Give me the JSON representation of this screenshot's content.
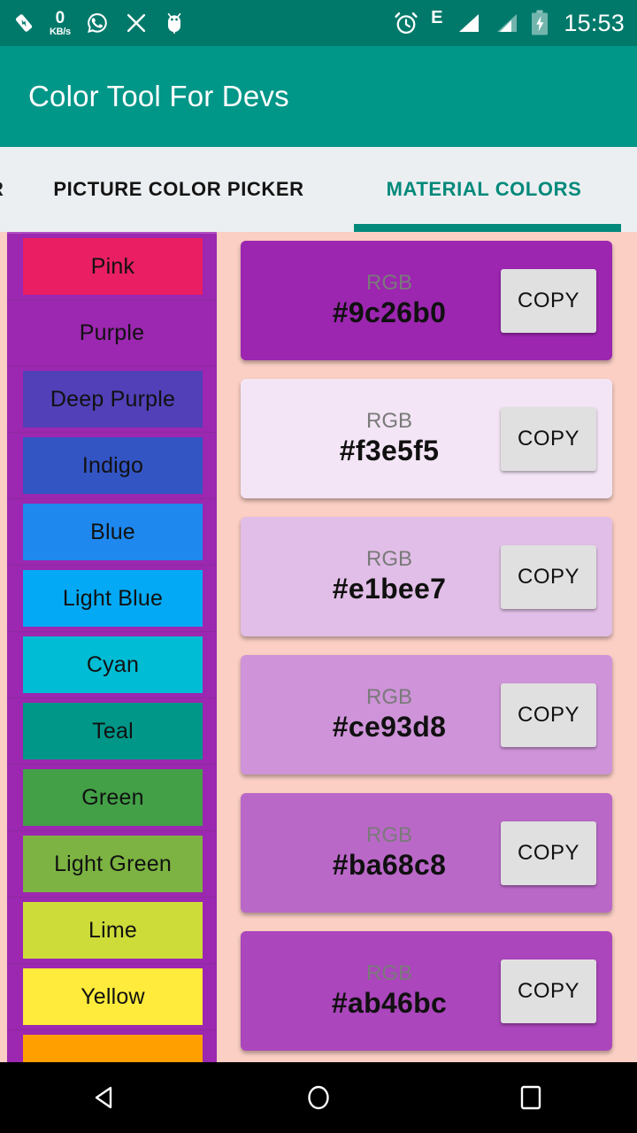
{
  "statusbar": {
    "left_icons": [
      {
        "name": "battery-saver-icon"
      },
      {
        "name": "network-speed-icon",
        "value": "0",
        "unit": "KB/s"
      },
      {
        "name": "whatsapp-icon"
      },
      {
        "name": "close-icon"
      },
      {
        "name": "android-debug-icon"
      }
    ],
    "alarm_icon": "alarm-icon",
    "network_type": "E",
    "signal_icon_1": "signal-bars-icon",
    "signal_icon_2": "signal-bars-icon",
    "battery_icon": "battery-charging-icon",
    "clock": "15:53"
  },
  "appbar": {
    "title": "Color Tool For Devs",
    "background": "#009688"
  },
  "tabs": {
    "items": [
      {
        "label": "R",
        "selected": false,
        "partial": true
      },
      {
        "label": "PICTURE COLOR PICKER",
        "selected": false,
        "partial": false
      },
      {
        "label": "MATERIAL COLORS",
        "selected": true,
        "partial": false
      }
    ],
    "indicator_color": "#00897b",
    "bar_background": "#eceff1"
  },
  "content": {
    "background": "#fbcfc4",
    "sidebar_background": "#9c27b0"
  },
  "color_list": {
    "items": [
      {
        "label": "Pink",
        "swatch": "#e91e63",
        "selected": false
      },
      {
        "label": "Purple",
        "swatch": "#9c27b0",
        "selected": true
      },
      {
        "label": "Deep Purple",
        "swatch": "#5140b7",
        "selected": false
      },
      {
        "label": "Indigo",
        "swatch": "#3355c4",
        "selected": false
      },
      {
        "label": "Blue",
        "swatch": "#1e88ef",
        "selected": false
      },
      {
        "label": "Light Blue",
        "swatch": "#03a9f4",
        "selected": false
      },
      {
        "label": "Cyan",
        "swatch": "#00bcd4",
        "selected": false
      },
      {
        "label": "Teal",
        "swatch": "#009688",
        "selected": false
      },
      {
        "label": "Green",
        "swatch": "#43a047",
        "selected": false
      },
      {
        "label": "Light Green",
        "swatch": "#7cb342",
        "selected": false
      },
      {
        "label": "Lime",
        "swatch": "#cddc39",
        "selected": false
      },
      {
        "label": "Yellow",
        "swatch": "#ffeb3b",
        "selected": false
      },
      {
        "label": "",
        "swatch": "#ffa000",
        "selected": false
      }
    ]
  },
  "shades": {
    "rgb_label": "RGB",
    "copy_label": "COPY",
    "items": [
      {
        "hex": "#9c26b0",
        "background": "#9c26b0"
      },
      {
        "hex": "#f3e5f5",
        "background": "#f3e5f5"
      },
      {
        "hex": "#e1bee7",
        "background": "#e1bee7"
      },
      {
        "hex": "#ce93d8",
        "background": "#ce93d8"
      },
      {
        "hex": "#ba68c8",
        "background": "#ba68c8"
      },
      {
        "hex": "#ab46bc",
        "background": "#ab46bc"
      }
    ]
  },
  "navbar": {
    "back": "back-icon",
    "home": "home-icon",
    "recents": "recents-icon"
  }
}
